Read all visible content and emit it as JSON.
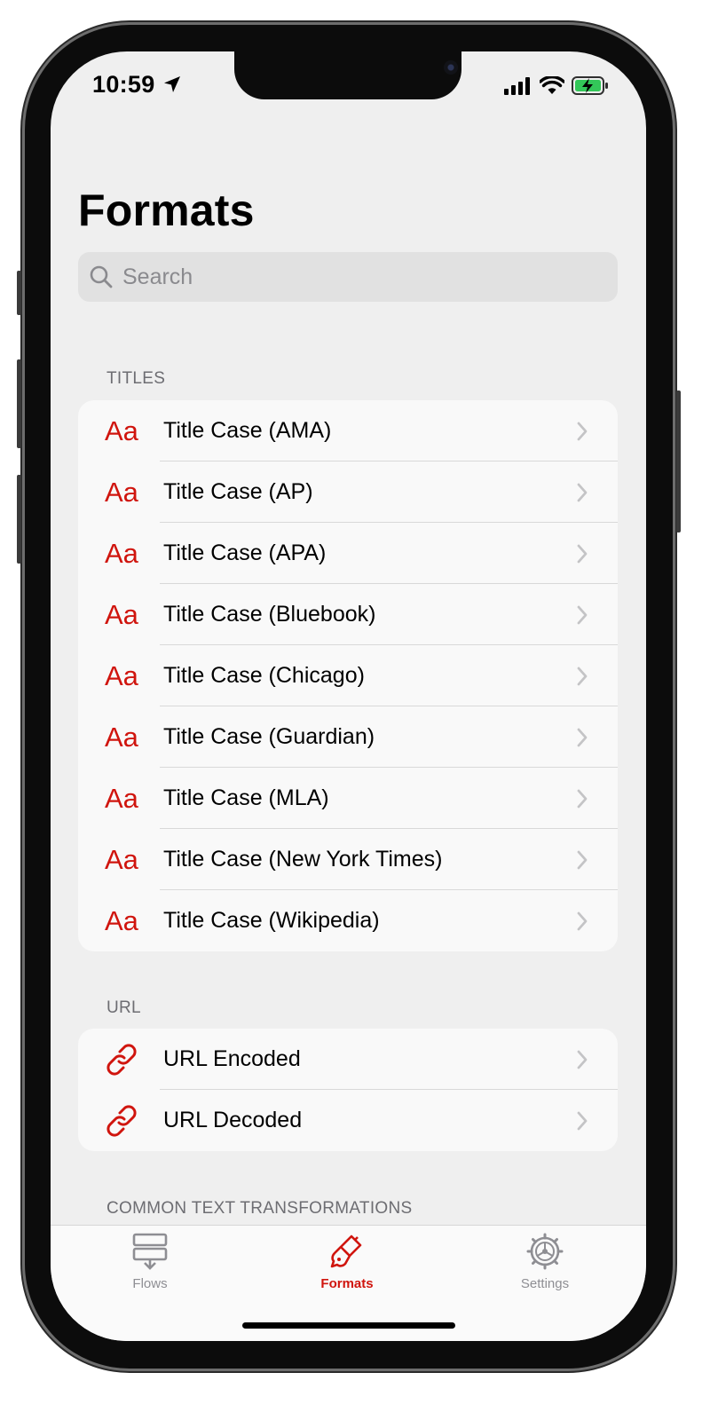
{
  "status_bar": {
    "time": "10:59"
  },
  "header": {
    "title": "Formats"
  },
  "search": {
    "placeholder": "Search"
  },
  "sections": {
    "titles": {
      "header": "TITLES",
      "icon_text": "Aa",
      "items": [
        "Title Case (AMA)",
        "Title Case (AP)",
        "Title Case (APA)",
        "Title Case (Bluebook)",
        "Title Case (Chicago)",
        "Title Case (Guardian)",
        "Title Case (MLA)",
        "Title Case (New York Times)",
        "Title Case (Wikipedia)"
      ]
    },
    "url": {
      "header": "URL",
      "items": [
        "URL Encoded",
        "URL Decoded"
      ]
    },
    "common": {
      "header": "COMMON TEXT TRANSFORMATIONS"
    }
  },
  "tabbar": {
    "tabs": [
      {
        "label": "Flows",
        "icon": "flows-icon",
        "active": false
      },
      {
        "label": "Formats",
        "icon": "paintbrush-icon",
        "active": true
      },
      {
        "label": "Settings",
        "icon": "gear-icon",
        "active": false
      }
    ]
  },
  "colors": {
    "accent": "#d0150e",
    "inactive": "#8e8e93",
    "background": "#efefef"
  }
}
